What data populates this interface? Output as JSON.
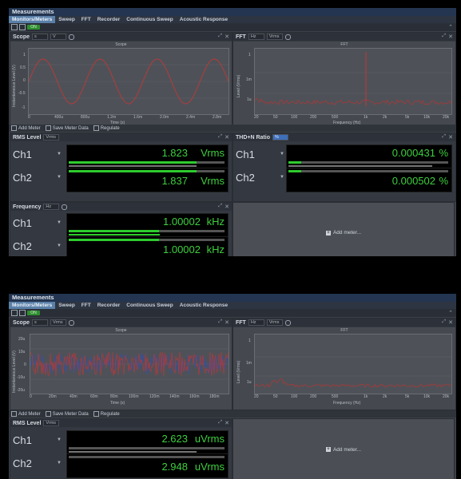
{
  "app": {
    "title": "Measurements",
    "tabs": [
      "Monitors/Meters",
      "Sweep",
      "FFT",
      "Recorder",
      "Continuous Sweep",
      "Acoustic Response"
    ],
    "on_label": "ON"
  },
  "screen1": {
    "scope": {
      "label": "Scope",
      "x_unit": "s",
      "y_unit": "V",
      "title": "Scope",
      "ylabel": "Instantaneous Level (V)",
      "xlabel": "Time (s)",
      "yticks": [
        "1",
        "0.5",
        "0",
        "-0.5",
        "-1"
      ],
      "xticks": [
        "0",
        "400u",
        "800u",
        "1.2m",
        "1.6m",
        "2.0m",
        "2.4m",
        "2.8m"
      ]
    },
    "fft": {
      "label": "FFT",
      "x_unit": "Hz",
      "y_unit": "Vrms",
      "title": "FFT",
      "ylabel": "Level (Vrms)",
      "xlabel": "Frequency (Hz)",
      "yticks": [
        "1",
        "1m",
        "1u"
      ],
      "xticks": [
        "20",
        "50",
        "100",
        "200",
        "500",
        "1k",
        "2k",
        "5k",
        "10k",
        "20k"
      ]
    },
    "meter_bar": {
      "add": "Add Meter",
      "save": "Save Meter Data",
      "regulate": "Regulate"
    },
    "rms": {
      "label": "RMS Level",
      "unit_sel": "Vrms",
      "ch1": {
        "name": "Ch1",
        "value": "1.823",
        "unit": "Vrms",
        "fill": 0.82
      },
      "ch2": {
        "name": "Ch2",
        "value": "1.837",
        "unit": "Vrms",
        "fill": 0.82
      }
    },
    "thd": {
      "label": "THD+N Ratio",
      "unit_sel": "%",
      "ch1": {
        "name": "Ch1",
        "value": "0.000431",
        "unit": "%",
        "fill": 0.08
      },
      "ch2": {
        "name": "Ch2",
        "value": "0.000502",
        "unit": "%",
        "fill": 0.08
      }
    },
    "freq": {
      "label": "Frequency",
      "unit_sel": "Hz",
      "ch1": {
        "name": "Ch1",
        "value": "1.00002",
        "unit": "kHz",
        "fill": 0.58
      },
      "ch2": {
        "name": "Ch2",
        "value": "1.00002",
        "unit": "kHz",
        "fill": 0.58
      }
    },
    "add_meter": "Add meter..."
  },
  "screen2": {
    "scope": {
      "label": "Scope",
      "x_unit": "s",
      "y_unit": "Vrms",
      "title": "Scope",
      "ylabel": "Instantaneous Level (V)",
      "xlabel": "Time (s)",
      "yticks": [
        "20u",
        "10u",
        "0",
        "-10u",
        "-20u"
      ],
      "xticks": [
        "0",
        "20m",
        "40m",
        "60m",
        "80m",
        "100m",
        "120m",
        "140m",
        "160m",
        "180m"
      ]
    },
    "fft": {
      "label": "FFT",
      "x_unit": "Hz",
      "y_unit": "Vrms",
      "title": "FFT",
      "ylabel": "Level (Vrms)",
      "xlabel": "Frequency (Hz)",
      "yticks": [
        "1",
        "1m",
        "1u"
      ],
      "xticks": [
        "20",
        "50",
        "100",
        "200",
        "500",
        "1k",
        "2k",
        "5k",
        "10k",
        "20k"
      ]
    },
    "meter_bar": {
      "add": "Add Meter",
      "save": "Save Meter Data",
      "regulate": "Regulate"
    },
    "rms": {
      "label": "RMS Level",
      "unit_sel": "Vrms",
      "ch1": {
        "name": "Ch1",
        "value": "2.623",
        "unit": "uVrms"
      },
      "ch2": {
        "name": "Ch2",
        "value": "2.948",
        "unit": "uVrms"
      }
    },
    "add_meter": "Add meter..."
  }
}
